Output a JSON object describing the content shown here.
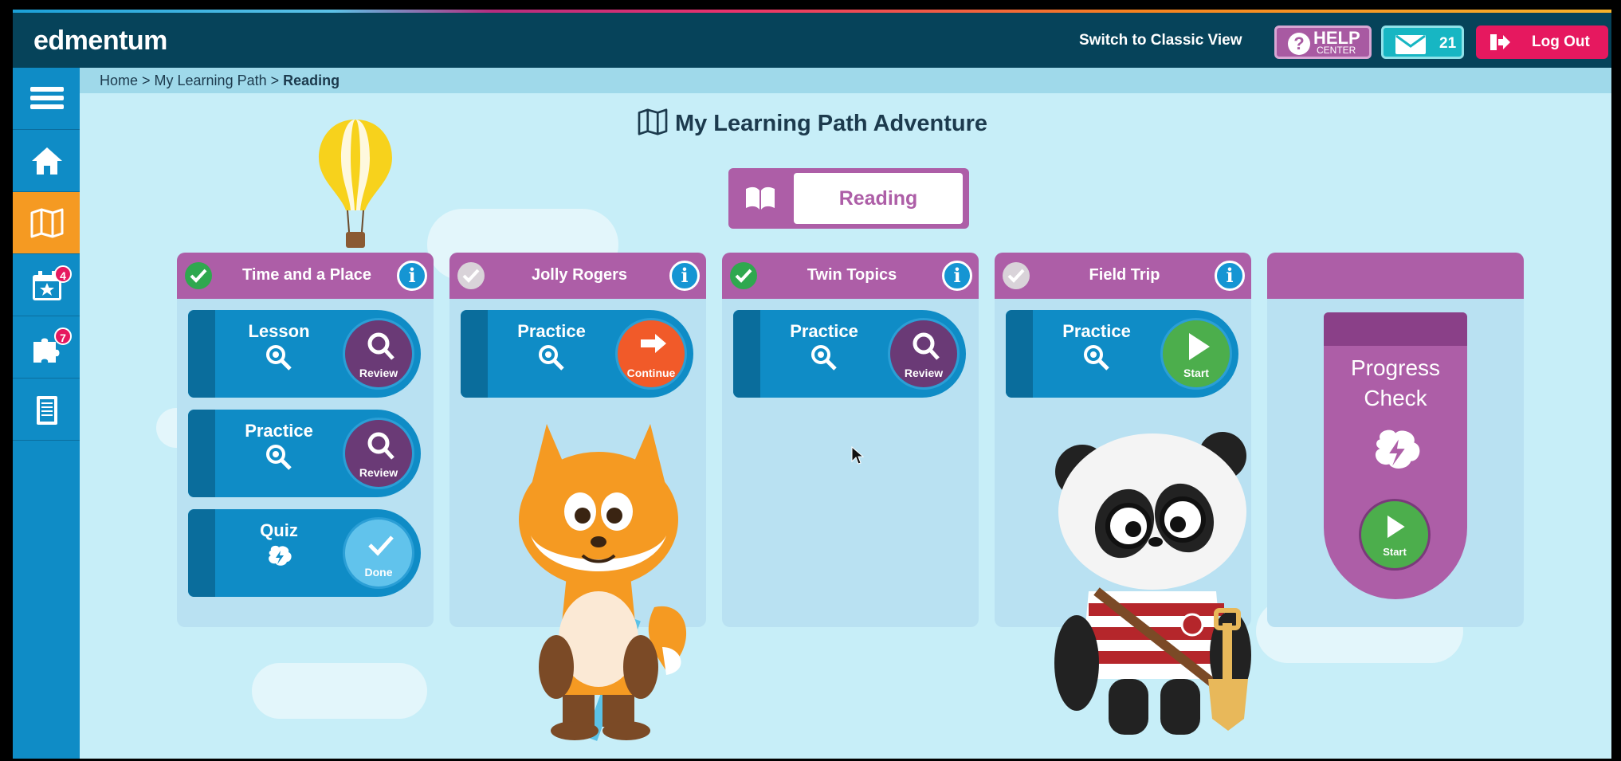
{
  "header": {
    "logo": "edmentum",
    "classic_view": "Switch to Classic View",
    "help_main": "HELP",
    "help_sub": "CENTER",
    "messages_count": "21",
    "logout": "Log Out"
  },
  "sidebar": {
    "items": [
      {
        "icon": "menu-icon"
      },
      {
        "icon": "home-icon"
      },
      {
        "icon": "map-icon",
        "active": true
      },
      {
        "icon": "calendar-star-icon",
        "badge": "4"
      },
      {
        "icon": "puzzle-icon",
        "badge": "7"
      },
      {
        "icon": "notebook-icon"
      }
    ]
  },
  "breadcrumb": {
    "part1": "Home > My Learning Path > ",
    "current": "Reading"
  },
  "page": {
    "title": "My Learning Path Adventure"
  },
  "subject": {
    "label": "Reading"
  },
  "columns": [
    {
      "title": "Time and a Place",
      "status": "complete",
      "activities": [
        {
          "name": "Lesson",
          "action": "Review"
        },
        {
          "name": "Practice",
          "action": "Review"
        },
        {
          "name": "Quiz",
          "action": "Done"
        }
      ]
    },
    {
      "title": "Jolly Rogers",
      "status": "incomplete",
      "activities": [
        {
          "name": "Practice",
          "action": "Continue"
        }
      ]
    },
    {
      "title": "Twin Topics",
      "status": "complete",
      "activities": [
        {
          "name": "Practice",
          "action": "Review"
        }
      ]
    },
    {
      "title": "Field Trip",
      "status": "incomplete",
      "activities": [
        {
          "name": "Practice",
          "action": "Start"
        }
      ]
    }
  ],
  "progress_check": {
    "line1": "Progress",
    "line2": "Check",
    "action": "Start"
  },
  "colors": {
    "header_bg": "#06435a",
    "sidebar_bg": "#0f8cc6",
    "accent_orange": "#f59a22",
    "purple": "#ad5ea7",
    "page_bg": "#c7eef8"
  }
}
